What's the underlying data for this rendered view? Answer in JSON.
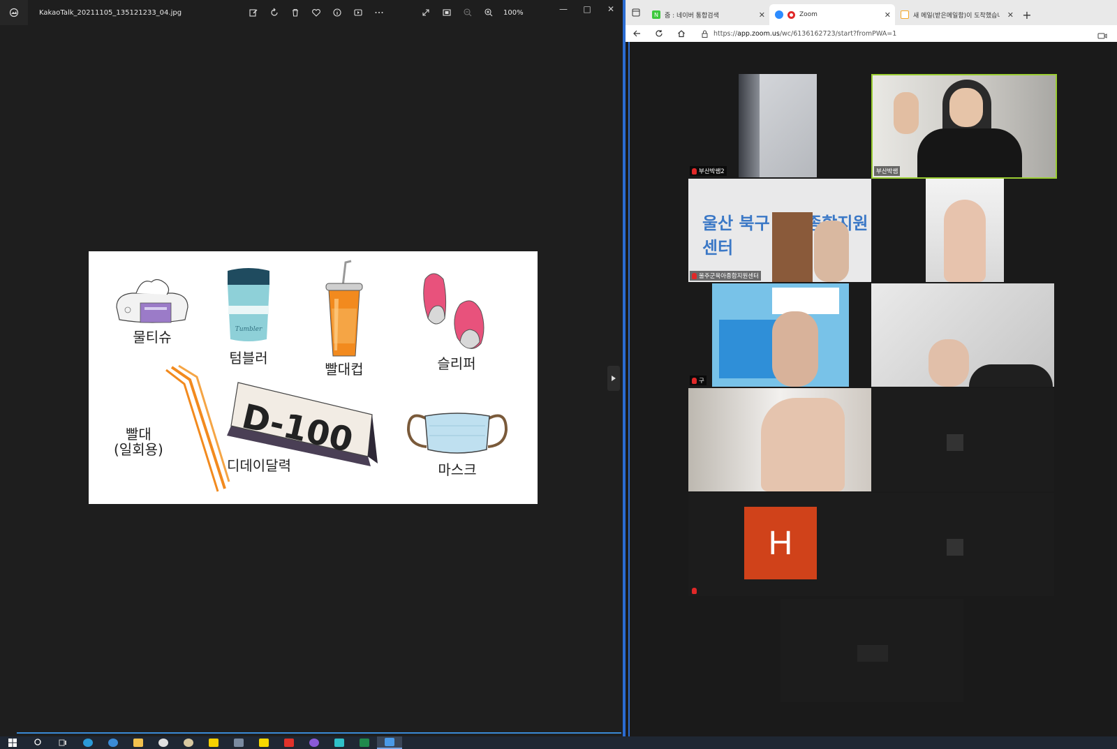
{
  "photos": {
    "filename": "KakaoTalk_20211105_135121233_04.jpg",
    "zoom_level": "100%",
    "items": [
      {
        "label": "물티슈"
      },
      {
        "label": "텀블러"
      },
      {
        "label": "빨대컵"
      },
      {
        "label": "슬리퍼"
      },
      {
        "label": "빨대\n(일회용)"
      },
      {
        "label": "디데이달력"
      },
      {
        "label": "마스크"
      }
    ],
    "calendar_text": "D-100",
    "tumbler_text": "Tumbler"
  },
  "browser": {
    "tabs": [
      {
        "label": "줌 : 네이버 통합검색",
        "favicon_color": "#3cc83c",
        "favicon_letter": "N"
      },
      {
        "label": "Zoom",
        "favicon_color": "#2d8cff",
        "active": true,
        "record_color": "#e02828"
      },
      {
        "label": "새 메일(받은메일함)이 도착했습니",
        "favicon_color": "#f5a623"
      }
    ],
    "new_tab": "+",
    "url_prefix": "https://",
    "url_host": "app.zoom.us",
    "url_path": "/wc/6136162723/start?fromPWA=1"
  },
  "zoom": {
    "participants": [
      {
        "name": "부산박쌤2"
      },
      {
        "name": "부산박쌤",
        "active_speaker": true
      },
      {
        "name": "울주군육아종합지원센터"
      },
      {
        "name": ""
      },
      {
        "name": "구"
      },
      {
        "name": ""
      },
      {
        "name": ""
      },
      {
        "name": ""
      },
      {
        "name": "",
        "avatar_letter": "H"
      },
      {
        "name": ""
      },
      {
        "name": ""
      }
    ],
    "banner_text": "울산 북구 육아종합지원센터"
  },
  "colors": {
    "accent": "#2b6cd1",
    "active_speaker": "#9acd32",
    "avatar_bg": "#d0421a"
  }
}
